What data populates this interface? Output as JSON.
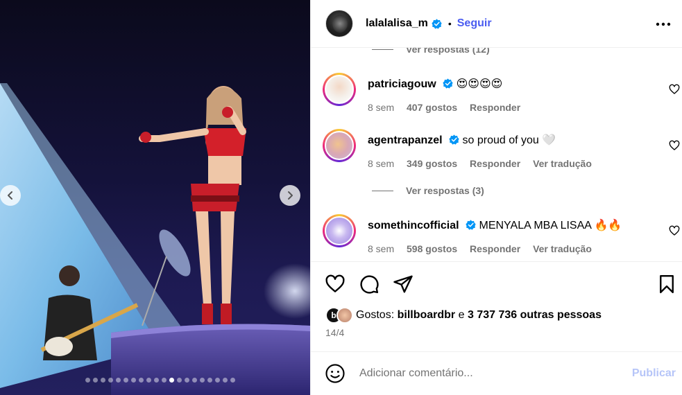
{
  "header": {
    "username": "lalalalisa_m",
    "separator": "•",
    "follow_label": "Seguir",
    "more_icon": "more-horizontal-icon"
  },
  "carousel": {
    "total_slides": 20,
    "active_index": 11,
    "prev_icon": "chevron-left-icon",
    "next_icon": "chevron-right-icon"
  },
  "comments": {
    "top_view_replies": "Ver respostas (12)",
    "items": [
      {
        "username": "patriciagouw",
        "text": "😍😍😍😍",
        "time": "8 sem",
        "likes": "407 gostos",
        "reply": "Responder",
        "translate": ""
      },
      {
        "username": "agentrapanzel",
        "text": "so proud of you 🤍",
        "time": "8 sem",
        "likes": "349 gostos",
        "reply": "Responder",
        "translate": "Ver tradução"
      },
      {
        "username": "somethincofficial",
        "text": "MENYALA MBA LISAA 🔥🔥",
        "time": "8 sem",
        "likes": "598 gostos",
        "reply": "Responder",
        "translate": "Ver tradução"
      }
    ],
    "mid_view_replies": "Ver respostas (3)"
  },
  "actions": {
    "like_icon": "heart-icon",
    "comment_icon": "comment-icon",
    "share_icon": "share-icon",
    "save_icon": "bookmark-icon"
  },
  "likes": {
    "prefix": "Gostos:",
    "first_user": "billboardbr",
    "conjunction": "e",
    "others": "3 737 736 outras pessoas"
  },
  "date": "14/4",
  "add_comment": {
    "placeholder": "Adicionar comentário...",
    "publish_label": "Publicar",
    "emoji_icon": "emoji-icon"
  },
  "colors": {
    "link_blue": "#4a5cf0",
    "publish_disabled": "#b6c5f8",
    "verified_blue": "#0095f6",
    "secondary_text": "#737373"
  }
}
